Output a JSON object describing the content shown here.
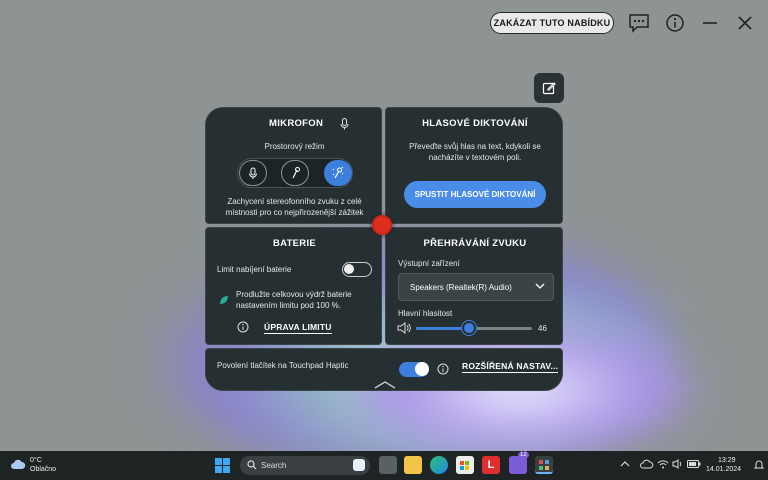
{
  "header": {
    "disable_button": "ZAKÁZAT TUTO NABÍDKU"
  },
  "microphone": {
    "title": "MIKROFON",
    "mode_label": "Prostorový režim",
    "description": "Zachycení stereofonního zvuku z celé místnosti pro co nejpřirozenější zážitek"
  },
  "dictation": {
    "title": "HLASOVÉ DIKTOVÁNÍ",
    "description": "Převeďte svůj hlas na text, kdykoli se nacházíte v textovém poli.",
    "button": "SPUSTIT HLASOVÉ DIKTOVÁNÍ"
  },
  "battery": {
    "title": "BATERIE",
    "limit_label": "Limit nabíjení baterie",
    "limit_enabled": false,
    "description": "Prodlužte celkovou výdrž baterie nastavením limitu pod 100 %.",
    "edit_link": "ÚPRAVA LIMITU"
  },
  "audio": {
    "title": "PŘEHRÁVÁNÍ ZVUKU",
    "output_label": "Výstupní zařízení",
    "output_value": "Speakers (Realtek(R) Audio)",
    "volume_label": "Hlavní hlasitost",
    "volume_value": "46",
    "volume_fraction": 0.46
  },
  "bottom": {
    "haptic_label": "Povolení tlačítek na Touchpad Haptic",
    "haptic_enabled": true,
    "advanced_link": "ROZŠÍŘENÁ NASTAV..."
  },
  "taskbar": {
    "weather_temp": "0°C",
    "weather_desc": "Oblačno",
    "search_placeholder": "Search",
    "badge_count": "12",
    "time": "13:29",
    "date": "14.01.2024"
  },
  "colors": {
    "accent": "#3d7fdc",
    "panel": "#263032",
    "record": "#e02e1e"
  }
}
